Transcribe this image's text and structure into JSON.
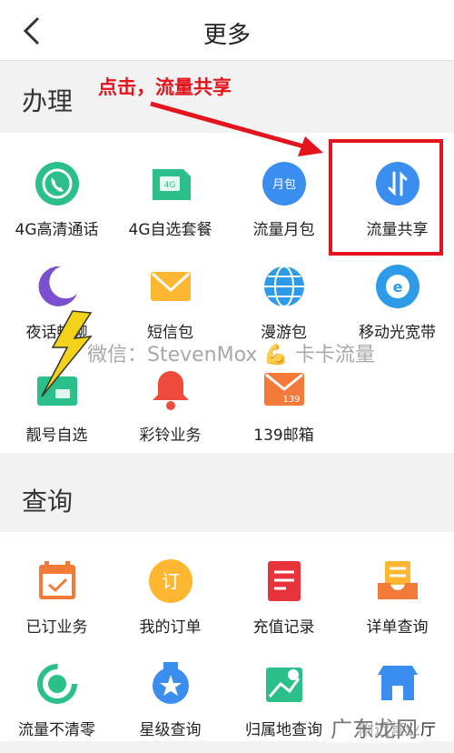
{
  "header": {
    "title": "更多"
  },
  "sections": {
    "handle": {
      "title": "办理"
    },
    "query": {
      "title": "查询"
    }
  },
  "handle_items": [
    {
      "label": "4G高清通话",
      "icon": "phone-call-icon"
    },
    {
      "label": "4G自选套餐",
      "icon": "sim-card-icon"
    },
    {
      "label": "流量月包",
      "icon": "data-pack-icon",
      "icon_text": "月包"
    },
    {
      "label": "流量共享",
      "icon": "data-share-icon"
    },
    {
      "label": "夜话畅聊",
      "icon": "moon-icon"
    },
    {
      "label": "短信包",
      "icon": "envelope-icon"
    },
    {
      "label": "漫游包",
      "icon": "globe-icon"
    },
    {
      "label": "移动光宽带",
      "icon": "broadband-icon"
    },
    {
      "label": "靓号自选",
      "icon": "number-card-icon"
    },
    {
      "label": "彩铃业务",
      "icon": "bell-icon"
    },
    {
      "label": "139邮箱",
      "icon": "mailbox-icon",
      "icon_text": "139"
    }
  ],
  "query_items": [
    {
      "label": "已订业务",
      "icon": "calendar-check-icon"
    },
    {
      "label": "我的订单",
      "icon": "order-icon",
      "icon_text": "订"
    },
    {
      "label": "充值记录",
      "icon": "recharge-record-icon"
    },
    {
      "label": "详单查询",
      "icon": "bill-detail-icon"
    },
    {
      "label": "流量不清零",
      "icon": "refresh-icon"
    },
    {
      "label": "星级查询",
      "icon": "star-badge-icon"
    },
    {
      "label": "归属地查询",
      "icon": "map-pin-icon"
    },
    {
      "label": "附近营业厅",
      "icon": "store-icon"
    }
  ],
  "annotation": {
    "text": "点击，流量共享"
  },
  "watermark": {
    "text": "微信：StevenMox",
    "brand": "卡卡流量"
  },
  "site_mark": {
    "text": "广东龙网"
  },
  "colors": {
    "green": "#2bbf8a",
    "blue": "#3a8ef0",
    "purple": "#7a4fd0",
    "orange": "#ffb630",
    "red": "#ef4b3c",
    "annotation_red": "#e3141d"
  }
}
